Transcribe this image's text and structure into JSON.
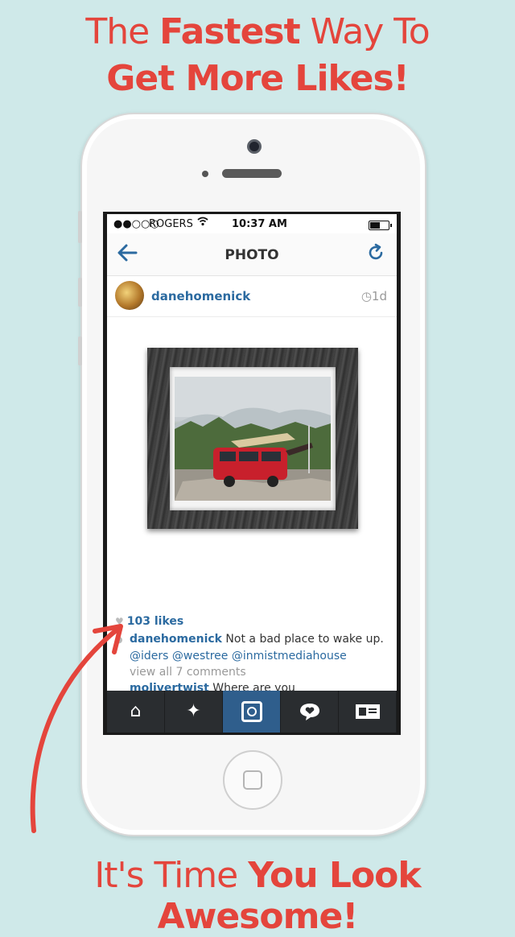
{
  "headline": {
    "line1_thin_a": "The ",
    "line1_bold": "Fastest",
    "line1_thin_b": " Way To",
    "line2": "Get More Likes!",
    "footer_thin": "It's Time ",
    "footer_bold": "You Look Awesome!"
  },
  "colors": {
    "accent": "#e4453c",
    "background": "#cfe9e9",
    "link": "#2b6aa0",
    "tabbar": "#2a2d30",
    "tab_active": "#2f5e8c"
  },
  "statusbar": {
    "signal": "●●○○○",
    "carrier": "ROGERS",
    "wifi_icon": "wifi-icon",
    "time": "10:37 AM",
    "battery_icon": "battery-icon"
  },
  "navbar": {
    "back_icon": "←",
    "title": "PHOTO",
    "refresh_icon": "↻"
  },
  "post": {
    "username": "danehomenick",
    "time": "◷1d",
    "likes": "103 likes",
    "caption_user": "danehomenick",
    "caption_text": " Not a bad place to wake up.",
    "caption_mentions": "@iders @westree @inmistmediahouse",
    "view_all": "view all 7 comments",
    "comment_user": "molivertwist",
    "comment_text": " Where are you"
  },
  "tabbar": {
    "home_icon": "⌂",
    "explore_icon": "✦",
    "camera_icon": "camera-icon",
    "activity_icon": "speech-heart-icon",
    "profile_icon": "profile-card-icon"
  }
}
